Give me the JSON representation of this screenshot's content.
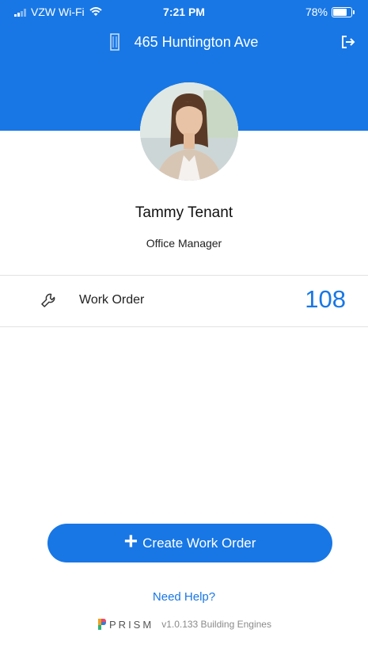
{
  "status_bar": {
    "carrier": "VZW Wi-Fi",
    "time": "7:21 PM",
    "battery": "78%",
    "battery_level": 0.78
  },
  "header": {
    "building_name": "465 Huntington Ave",
    "background_color": "#1877e5",
    "building_icon": "building-icon",
    "logout_icon": "logout-icon"
  },
  "profile": {
    "name": "Tammy Tenant",
    "role": "Office Manager"
  },
  "work_order": {
    "icon": "wrench-icon",
    "label": "Work Order",
    "count": "108"
  },
  "actions": {
    "create_label": "Create Work Order",
    "help_label": "Need Help?"
  },
  "footer": {
    "brand": "PRISM",
    "version_text": "v1.0.133 Building Engines"
  },
  "colors": {
    "accent": "#1877e5"
  }
}
